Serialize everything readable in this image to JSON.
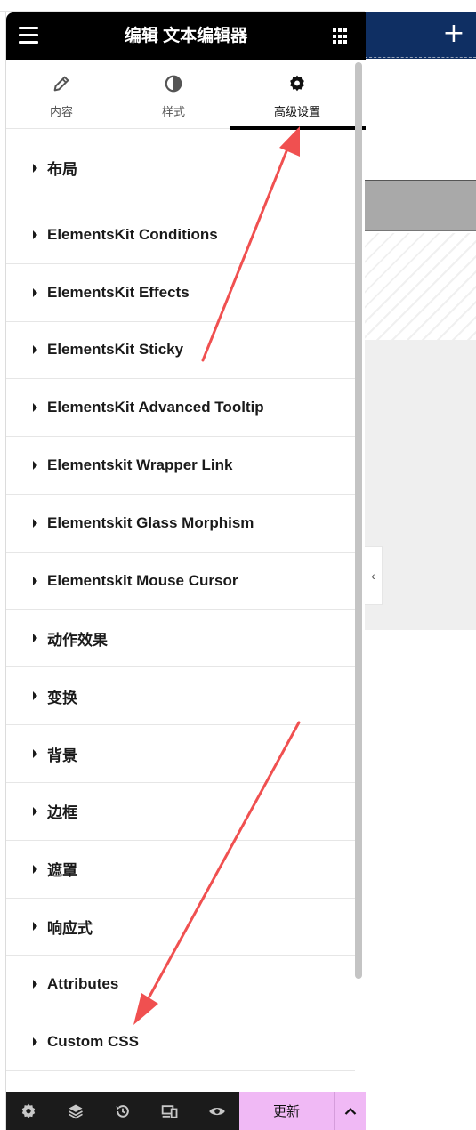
{
  "header": {
    "title": "编辑 文本编辑器"
  },
  "tabs": [
    {
      "label": "内容",
      "icon": "pencil-icon"
    },
    {
      "label": "样式",
      "icon": "contrast-icon"
    },
    {
      "label": "高级设置",
      "icon": "gear-icon",
      "active": true
    }
  ],
  "sections": [
    "布局",
    "ElementsKit Conditions",
    "ElementsKit Effects",
    "ElementsKit Sticky",
    "ElementsKit Advanced Tooltip",
    "Elementskit Wrapper Link",
    "Elementskit Glass Morphism",
    "Elementskit Mouse Cursor",
    "动作效果",
    "变换",
    "背景",
    "边框",
    "遮罩",
    "响应式",
    "Attributes",
    "Custom CSS"
  ],
  "footer": {
    "icons": [
      "settings-icon",
      "layers-icon",
      "history-icon",
      "responsive-icon",
      "preview-icon"
    ],
    "update_label": "更新"
  },
  "colors": {
    "header_bg": "#000000",
    "update_bg": "#f0b9f5",
    "canvas_topbar": "#0f2f63",
    "arrow": "#f05050"
  }
}
